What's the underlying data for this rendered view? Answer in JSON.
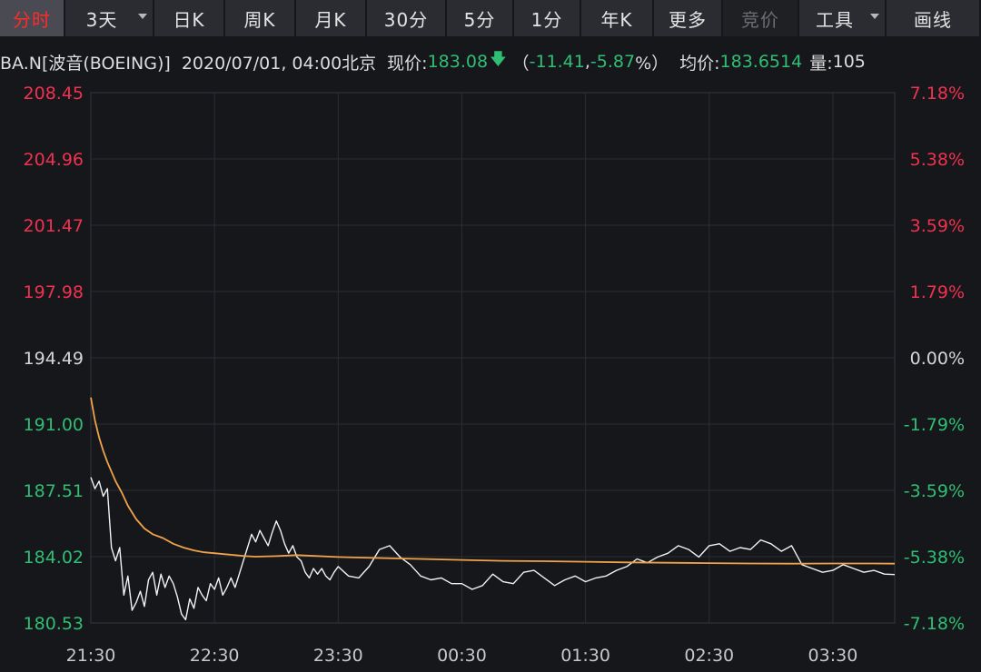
{
  "tabs": [
    {
      "label": "分时",
      "state": "active"
    },
    {
      "label": "3天",
      "state": "dropdown"
    },
    {
      "label": "日K",
      "state": "normal"
    },
    {
      "label": "周K",
      "state": "normal"
    },
    {
      "label": "月K",
      "state": "normal"
    },
    {
      "label": "30分",
      "state": "normal"
    },
    {
      "label": "5分",
      "state": "normal"
    },
    {
      "label": "1分",
      "state": "normal"
    },
    {
      "label": "年K",
      "state": "normal"
    },
    {
      "label": "更多",
      "state": "normal"
    },
    {
      "label": "竞价",
      "state": "disabled"
    },
    {
      "label": "工具",
      "state": "dropdown"
    },
    {
      "label": "画线",
      "state": "normal"
    }
  ],
  "info": {
    "symbol": "BA.N[波音(BOEING)]",
    "datetime": "2020/07/01, 04:00北京",
    "price_label": "现价:",
    "price": "183.08",
    "change_open": "（",
    "change": "-11.41",
    "change_sep": ", ",
    "change_pct": "-5.87",
    "change_close": "%）",
    "avg_label": "均价:",
    "avg": "183.6514",
    "vol_label": "量:",
    "vol": "105"
  },
  "colors": {
    "background": "#16171b",
    "grid": "#2c2d33",
    "up": "#f0314f",
    "down": "#2fbe74",
    "neutral": "#d6d6d6",
    "price_line": "#f2f2f2",
    "avg_line": "#f0a34a"
  },
  "chart_data": {
    "type": "line",
    "title": "",
    "xlabel": "",
    "ylabel": "",
    "prev_close": 194.49,
    "ylim": [
      180.53,
      208.45
    ],
    "y_ticks": [
      "208.45",
      "204.96",
      "201.47",
      "197.98",
      "194.49",
      "191.00",
      "187.51",
      "184.02",
      "180.53"
    ],
    "pct_ticks": [
      "7.18%",
      "5.38%",
      "3.59%",
      "1.79%",
      "0.00%",
      "-1.79%",
      "-3.59%",
      "-5.38%",
      "-7.18%"
    ],
    "x_tick_labels": [
      "21:30",
      "22:30",
      "23:30",
      "00:30",
      "01:30",
      "02:30",
      "03:30"
    ],
    "x_range_minutes": [
      0,
      390
    ],
    "grid": true,
    "series": [
      {
        "kind": "price",
        "x": [
          0,
          2,
          4,
          6,
          8,
          10,
          12,
          14,
          16,
          18,
          20,
          22,
          24,
          26,
          28,
          30,
          32,
          34,
          36,
          38,
          40,
          42,
          44,
          46,
          48,
          50,
          52,
          54,
          56,
          58,
          60,
          62,
          64,
          66,
          68,
          70,
          72,
          74,
          76,
          78,
          80,
          82,
          84,
          86,
          88,
          90,
          92,
          94,
          96,
          98,
          100,
          102,
          104,
          106,
          108,
          110,
          112,
          114,
          116,
          118,
          120,
          125,
          130,
          135,
          140,
          145,
          150,
          155,
          160,
          165,
          170,
          175,
          180,
          185,
          190,
          195,
          200,
          205,
          210,
          215,
          220,
          225,
          230,
          235,
          240,
          245,
          250,
          255,
          260,
          265,
          270,
          275,
          280,
          285,
          290,
          295,
          300,
          305,
          310,
          315,
          320,
          325,
          330,
          335,
          340,
          345,
          350,
          355,
          360,
          365,
          370,
          375,
          380,
          385,
          390
        ],
        "y": [
          188.2,
          187.6,
          188.0,
          187.2,
          187.6,
          184.5,
          183.8,
          184.5,
          182.0,
          183.0,
          181.2,
          181.6,
          182.2,
          181.4,
          182.8,
          183.2,
          182.0,
          183.1,
          182.4,
          183.0,
          182.6,
          181.9,
          181.0,
          180.7,
          181.8,
          181.3,
          182.4,
          182.0,
          181.7,
          182.6,
          182.3,
          182.9,
          182.0,
          182.4,
          182.9,
          182.4,
          183.1,
          183.8,
          184.5,
          185.2,
          184.8,
          185.4,
          185.0,
          184.6,
          185.3,
          185.9,
          185.4,
          184.7,
          184.2,
          184.6,
          184.0,
          183.8,
          183.2,
          182.9,
          183.4,
          183.1,
          183.4,
          183.0,
          182.8,
          183.2,
          183.5,
          183.0,
          182.9,
          183.5,
          184.4,
          184.6,
          184.0,
          183.6,
          183.0,
          182.8,
          182.9,
          182.6,
          182.6,
          182.3,
          182.5,
          183.1,
          182.7,
          182.6,
          183.2,
          183.3,
          182.9,
          182.5,
          182.8,
          183.0,
          182.7,
          182.9,
          183.0,
          183.3,
          183.5,
          183.9,
          183.7,
          184.0,
          184.2,
          184.6,
          184.4,
          184.0,
          184.6,
          184.7,
          184.3,
          184.5,
          184.4,
          184.9,
          184.7,
          184.3,
          184.6,
          183.6,
          183.4,
          183.2,
          183.3,
          183.6,
          183.4,
          183.2,
          183.3,
          183.1,
          183.08
        ]
      },
      {
        "kind": "average",
        "x": [
          0,
          2,
          4,
          6,
          8,
          10,
          12,
          15,
          18,
          22,
          26,
          30,
          35,
          40,
          45,
          50,
          55,
          60,
          65,
          70,
          75,
          80,
          90,
          100,
          120,
          140,
          160,
          180,
          200,
          220,
          240,
          260,
          280,
          300,
          320,
          340,
          360,
          380,
          390
        ],
        "y": [
          192.4,
          191.2,
          190.3,
          189.6,
          189.0,
          188.5,
          188.0,
          187.4,
          186.7,
          186.0,
          185.5,
          185.2,
          185.0,
          184.7,
          184.5,
          184.35,
          184.25,
          184.2,
          184.15,
          184.1,
          184.05,
          184.02,
          184.05,
          184.1,
          184.0,
          183.95,
          183.9,
          183.85,
          183.8,
          183.78,
          183.75,
          183.72,
          183.7,
          183.68,
          183.66,
          183.65,
          183.66,
          183.66,
          183.65
        ]
      }
    ]
  }
}
